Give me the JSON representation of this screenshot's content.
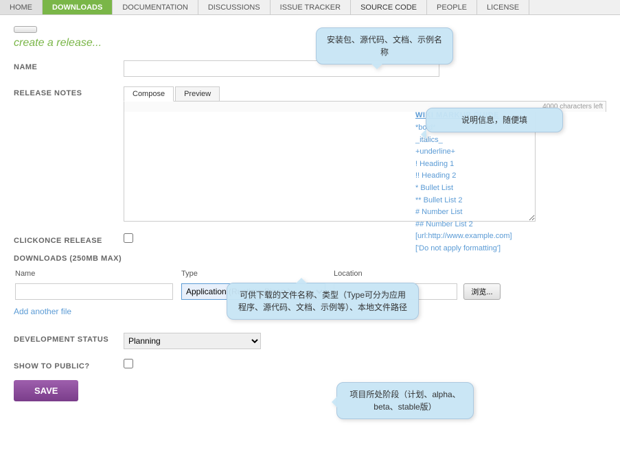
{
  "nav": {
    "items": [
      {
        "label": "HOME",
        "active": false
      },
      {
        "label": "DOWNLOADS",
        "active": true
      },
      {
        "label": "DOCUMENTATION",
        "active": false
      },
      {
        "label": "DISCUSSIONS",
        "active": false
      },
      {
        "label": "ISSUE TRACKER",
        "active": false
      },
      {
        "label": "SOURCE CODE",
        "active": false
      },
      {
        "label": "PEOPLE",
        "active": false
      },
      {
        "label": "LICENSE",
        "active": false
      }
    ]
  },
  "page": {
    "upload_btn": "",
    "title": "create a release...",
    "name_label": "NAME",
    "release_notes_label": "RELEASE NOTES",
    "tab_compose": "Compose",
    "tab_preview": "Preview",
    "char_count": "4000 characters left",
    "wiki_title": "WIKI MARKUP GUIDE",
    "wiki_items": [
      "*bold*",
      "_italics_",
      "+underline+",
      "! Heading 1",
      "!! Heading 2",
      "* Bullet List",
      "** Bullet List 2",
      "# Number List",
      "## Number List 2",
      "[url:http://www.example.com]",
      "['Do not apply formatting']"
    ],
    "clickonce_label": "CLICKONCE RELEASE",
    "downloads_label": "DOWNLOADS (250MB MAX)",
    "downloads_col_name": "Name",
    "downloads_col_type": "Type",
    "downloads_col_location": "Location",
    "type_option": "Application (Runtime Binary)",
    "browse_btn": "浏览...",
    "add_file_link": "Add another file",
    "dev_status_label": "DEVELOPMENT STATUS",
    "dev_status_value": "Planning",
    "show_public_label": "SHOW TO PUBLIC?",
    "save_btn": "SAVE"
  },
  "tooltips": {
    "name": "安装包、源代码、文档、示例名称",
    "notes": "说明信息，随便填",
    "downloads": "可供下载的文件名称、类型（Type可分为应用程序、源代码、文档、示例等）、本地文件路径",
    "devstatus": "项目所处阶段（计划、alpha、beta、stable版）"
  }
}
